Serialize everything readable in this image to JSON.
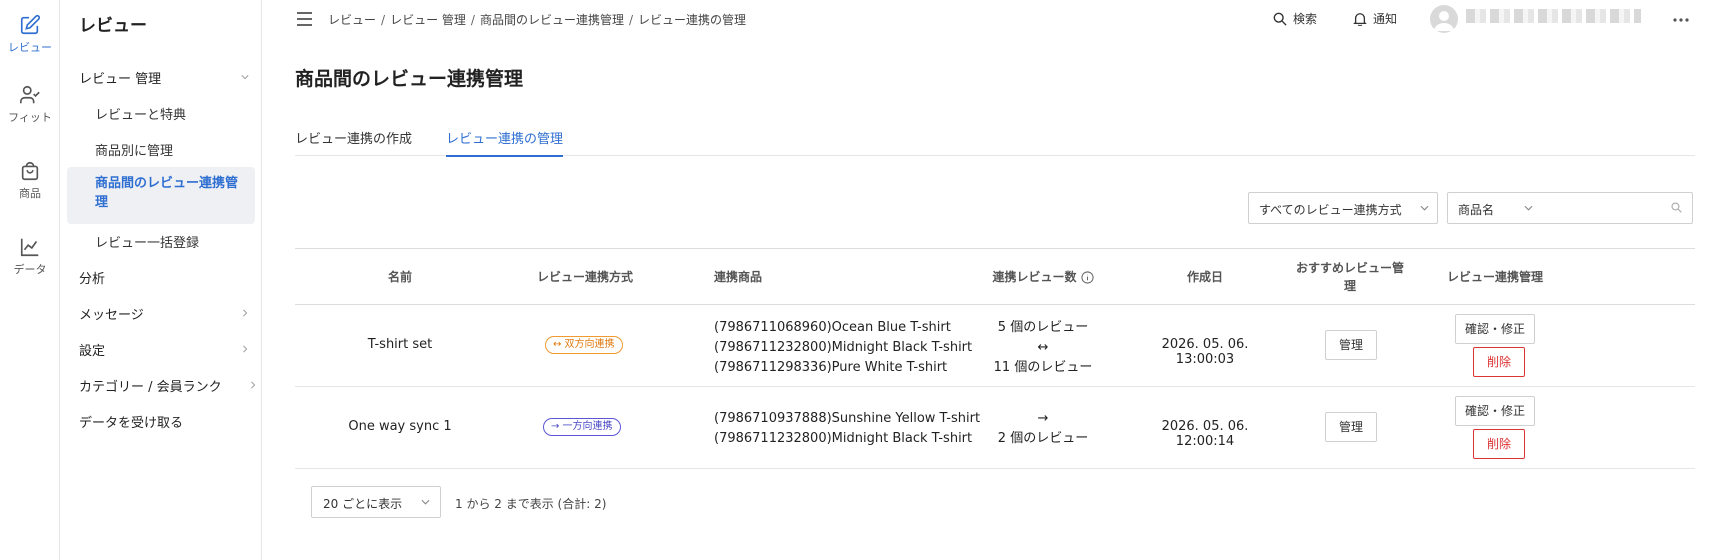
{
  "rail": {
    "items": [
      {
        "label": "レビュー",
        "icon": "edit-icon"
      },
      {
        "label": "フィット",
        "icon": "user-check-icon"
      },
      {
        "label": "商品",
        "icon": "shopping-bag-icon"
      },
      {
        "label": "データ",
        "icon": "line-chart-icon"
      }
    ]
  },
  "sidenav": {
    "title": "レビュー",
    "review_manage": "レビュー 管理",
    "sub_items": [
      "レビューと特典",
      "商品別に管理",
      "商品間のレビュー連携管理",
      "レビュー一括登録"
    ],
    "analysis": "分析",
    "messages": "メッセージ",
    "settings": "設定",
    "category": "カテゴリー / 会員ランク",
    "receive": "データを受け取る"
  },
  "topbar": {
    "breadcrumbs": [
      "レビュー",
      "レビュー 管理",
      "商品間のレビュー連携管理",
      "レビュー連携の管理"
    ],
    "search": "検索",
    "notify": "通知"
  },
  "page": {
    "title": "商品間のレビュー連携管理",
    "tabs": [
      "レビュー連携の作成",
      "レビュー連携の管理"
    ]
  },
  "filters": {
    "method": "すべてのレビュー連携方式",
    "field": "商品名",
    "search_value": ""
  },
  "table": {
    "headers": {
      "name": "名前",
      "method": "レビュー連携方式",
      "products": "連携商品",
      "count": "連携レビュー数",
      "created": "作成日",
      "recommend": "おすすめレビュー管理",
      "manage": "レビュー連携管理"
    },
    "rows": [
      {
        "name": "T-shirt set",
        "method": "↔ 双方向連携",
        "products": [
          "(7986711068960)Ocean Blue T-shirt",
          "(7986711232800)Midnight Black T-shirt",
          "(7986711298336)Pure White T-shirt"
        ],
        "count_lines": [
          "5 個のレビュー",
          "↔",
          "11 個のレビュー"
        ],
        "created": "2026. 05. 06. 13:00:03",
        "recommend_btn": "管理",
        "edit_btn": "確認・修正",
        "delete_btn": "削除"
      },
      {
        "name": "One way sync 1",
        "method": "→ 一方向連携",
        "products": [
          "(7986710937888)Sunshine Yellow T-shirt",
          "(7986711232800)Midnight Black T-shirt"
        ],
        "count_lines": [
          "→",
          "2 個のレビュー"
        ],
        "created": "2026. 05. 06. 12:00:14",
        "recommend_btn": "管理",
        "edit_btn": "確認・修正",
        "delete_btn": "削除"
      }
    ]
  },
  "footer": {
    "page_size": "20 ごとに表示",
    "info": "1 から 2 まで表示 (合計: 2)"
  },
  "colors": {
    "accent": "#2f6fd1",
    "danger": "#d33333",
    "two_way": "#f09a2f",
    "one_way": "#5a56d6"
  }
}
